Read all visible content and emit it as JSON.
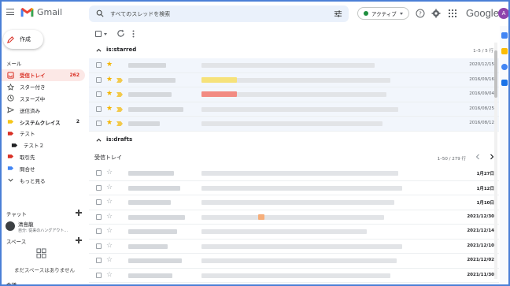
{
  "app": {
    "name": "Gmail",
    "google_label": "Google",
    "avatar_letter": "A"
  },
  "search": {
    "placeholder": "すべてのスレッドを検索"
  },
  "status": {
    "label": "アクティブ"
  },
  "compose": {
    "label": "作成"
  },
  "sidebar": {
    "mail_heading": "メール",
    "items": [
      {
        "label": "受信トレイ",
        "count": "262",
        "icon": "inbox-icon",
        "active": true
      },
      {
        "label": "スター付き",
        "count": "",
        "icon": "star-outline-icon"
      },
      {
        "label": "スヌーズ中",
        "count": "",
        "icon": "clock-icon"
      },
      {
        "label": "送信済み",
        "count": "",
        "icon": "send-icon"
      },
      {
        "label": "システムクレイス",
        "count": "2",
        "icon": "label-icon",
        "color": "#f5c518",
        "bold": true
      },
      {
        "label": "テスト",
        "count": "",
        "icon": "label-icon",
        "color": "#d93025"
      },
      {
        "label": "テスト２",
        "count": "",
        "icon": "label-icon",
        "color": "#202124",
        "indent": true
      },
      {
        "label": "取引先",
        "count": "",
        "icon": "label-icon",
        "color": "#d93025"
      },
      {
        "label": "問合せ",
        "count": "",
        "icon": "label-icon",
        "color": "#4285f4"
      },
      {
        "label": "もっと見る",
        "count": "",
        "icon": "chevron-down-icon"
      }
    ],
    "chat_heading": "チャット",
    "chat_user": {
      "name": "清島龍",
      "status": "自分: 従来のハングアウト..."
    },
    "spaces_heading": "スペース",
    "spaces_empty": "まだスペースはありません",
    "meet_heading": "会議"
  },
  "sections": {
    "starred": {
      "title": "is:starred",
      "range": "1–5 / 5 行",
      "rows": [
        {
          "date": "2020/12/15",
          "imp": false,
          "sender_w": 48,
          "subject_w": 220,
          "hl": ""
        },
        {
          "date": "2016/09/16",
          "imp": true,
          "sender_w": 60,
          "subject_w": 240,
          "hl": "#f6e27a"
        },
        {
          "date": "2016/09/04",
          "imp": true,
          "sender_w": 55,
          "subject_w": 235,
          "hl": "#f28b82"
        },
        {
          "date": "2016/08/25",
          "imp": true,
          "sender_w": 70,
          "subject_w": 250,
          "hl": ""
        },
        {
          "date": "2016/08/12",
          "imp": true,
          "sender_w": 40,
          "subject_w": 230,
          "hl": ""
        }
      ]
    },
    "drafts": {
      "title": "is:drafts"
    },
    "inbox": {
      "title": "受信トレイ",
      "range": "1–50 / 279 行",
      "rows": [
        {
          "date": "1月27日",
          "sender_w": 58,
          "subject_w": 250,
          "hl": ""
        },
        {
          "date": "1月12日",
          "sender_w": 66,
          "subject_w": 255,
          "hl": ""
        },
        {
          "date": "1月10日",
          "sender_w": 54,
          "subject_w": 245,
          "hl": ""
        },
        {
          "date": "2021/12/30",
          "sender_w": 72,
          "subject_w": 232,
          "hl": "#f6ae7a"
        },
        {
          "date": "2021/12/14",
          "sender_w": 62,
          "subject_w": 210,
          "hl": ""
        },
        {
          "date": "2021/12/10",
          "sender_w": 50,
          "subject_w": 255,
          "hl": ""
        },
        {
          "date": "2021/12/02",
          "sender_w": 68,
          "subject_w": 248,
          "hl": ""
        },
        {
          "date": "2021/11/30",
          "sender_w": 56,
          "subject_w": 240,
          "hl": ""
        }
      ]
    }
  },
  "colors": {
    "accent_red": "#d93025",
    "star_yellow": "#f4b400",
    "important_yellow": "#f2c94c",
    "frame_blue": "#4a7fd6"
  }
}
